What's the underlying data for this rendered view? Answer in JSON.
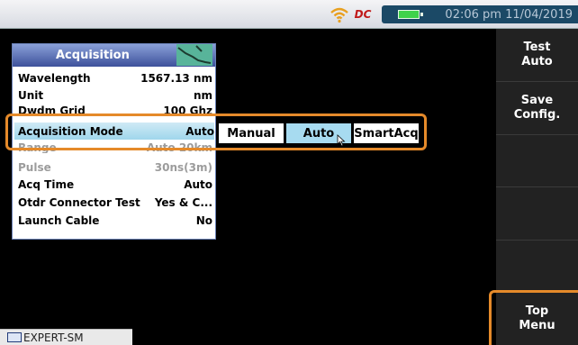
{
  "status": {
    "clock": "02:06 pm 11/04/2019",
    "dc_label": "DC"
  },
  "softkeys": [
    {
      "label": "Test\nAuto"
    },
    {
      "label": "Save\nConfig."
    },
    {
      "label": ""
    },
    {
      "label": ""
    },
    {
      "label": ""
    },
    {
      "label": "Top\nMenu"
    }
  ],
  "panel": {
    "title": "Acquisition",
    "rows": [
      {
        "label": "Wavelength",
        "value": "1567.13 nm"
      },
      {
        "label": "Unit",
        "value": "nm"
      },
      {
        "label": "Dwdm Grid",
        "value": "100 Ghz"
      },
      {
        "label": "Acquisition Mode",
        "value": "Auto"
      },
      {
        "label": "Range",
        "value": "Auto 20km"
      },
      {
        "label": "Pulse",
        "value": "30ns(3m)"
      },
      {
        "label": "Acq Time",
        "value": "Auto"
      },
      {
        "label": "Otdr Connector Test",
        "value": "Yes & C..."
      },
      {
        "label": "Launch Cable",
        "value": "No"
      }
    ]
  },
  "options": [
    {
      "label": "Manual"
    },
    {
      "label": "Auto"
    },
    {
      "label": "SmartAcq"
    }
  ],
  "bottom_tab": {
    "label": "EXPERT-SM"
  },
  "colors": {
    "highlight": "#e58a2a",
    "title_bar": "#3d519b",
    "selected_row": "#a7dbf0"
  }
}
